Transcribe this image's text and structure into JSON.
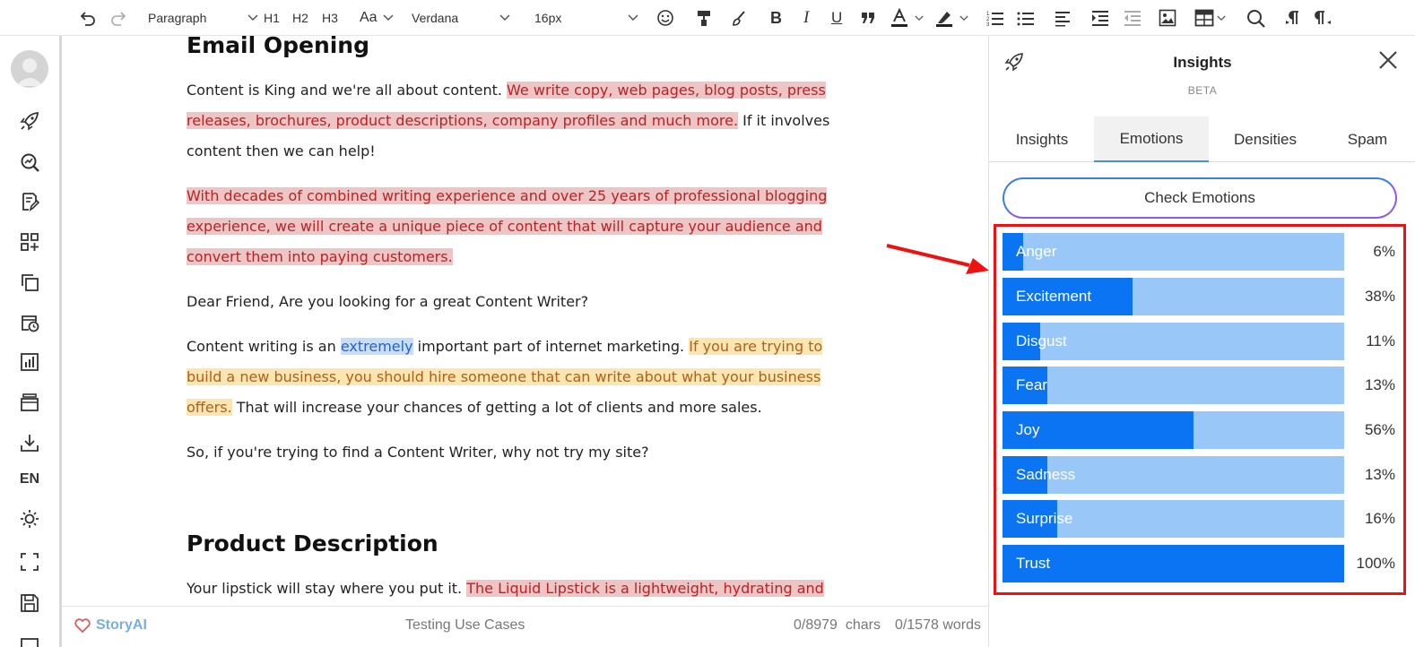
{
  "toolbar": {
    "block_format": "Paragraph",
    "h1": "H1",
    "h2": "H2",
    "h3": "H3",
    "text_case": "Aa",
    "font_family": "Verdana",
    "font_size": "16px"
  },
  "sidebar": {
    "language": "EN"
  },
  "document": {
    "heading1": "Email Opening",
    "p1": {
      "normal1": "Content is King and we're all about content. ",
      "hl1": "We write copy, web pages, blog posts, press releases, brochures, product descriptions, company profiles and much more.",
      "normal2": " If it involves content then we can help!"
    },
    "p2": {
      "hl1": "With decades of combined writing experience and over 25 years of professional blogging experience, we will create a unique piece of content that will capture your audience and convert them into paying customers."
    },
    "p3": {
      "normal1": "Dear Friend, Are you looking for a great Content Writer?"
    },
    "p4": {
      "normal1": "Content writing is an ",
      "hl_blue": "extremely",
      "normal2": " important part of internet marketing. ",
      "hl_yellow": "If you are trying to build a new business, you should hire someone that can write about what your business offers.",
      "normal3": " That will increase your chances of getting a lot of clients and more sales."
    },
    "p5": {
      "normal1": "So, if you're trying to find a Content Writer, why not try my site?"
    },
    "heading2": "Product Description",
    "p6": {
      "normal1": "Your lipstick will stay where you put it. ",
      "hl1": "The Liquid Lipstick is a lightweight, hydrating and"
    }
  },
  "statusbar": {
    "brand": "StoryAI",
    "doc_name": "Testing Use Cases",
    "chars": "0/8979  chars",
    "words": "0/1578 words"
  },
  "panel": {
    "title": "Insights",
    "subtitle": "BETA",
    "tabs": [
      "Insights",
      "Emotions",
      "Densities",
      "Spam"
    ],
    "active_tab": "Emotions",
    "check_button": "Check Emotions",
    "emotions": [
      {
        "name": "Anger",
        "percent": 6,
        "label": "6%"
      },
      {
        "name": "Excitement",
        "percent": 38,
        "label": "38%"
      },
      {
        "name": "Disgust",
        "percent": 11,
        "label": "11%"
      },
      {
        "name": "Fear",
        "percent": 13,
        "label": "13%"
      },
      {
        "name": "Joy",
        "percent": 56,
        "label": "56%"
      },
      {
        "name": "Sadness",
        "percent": 13,
        "label": "13%"
      },
      {
        "name": "Surprise",
        "percent": 16,
        "label": "16%"
      },
      {
        "name": "Trust",
        "percent": 100,
        "label": "100%"
      }
    ]
  },
  "colors": {
    "bar_fill": "#0a74f2",
    "bar_track": "#99c8f8",
    "highlight_box": "#ee1111",
    "highlight_red": "#efc4c4",
    "highlight_yellow": "#fbe5b0",
    "brand": "#7aaede"
  },
  "icons": {
    "toolbar": [
      "undo-icon",
      "redo-icon",
      "emoji-icon",
      "format-painter-icon",
      "clear-format-icon",
      "bold-icon",
      "italic-icon",
      "underline-icon",
      "quote-icon",
      "font-color-icon",
      "highlight-icon",
      "ordered-list-icon",
      "bullet-list-icon",
      "align-left-icon",
      "indent-icon",
      "outdent-icon",
      "image-icon",
      "table-icon",
      "search-icon",
      "ltr-icon",
      "rtl-icon"
    ],
    "sidebar": [
      "rocket-icon",
      "seo-search-icon",
      "edit-doc-icon",
      "apps-icon",
      "copy-icon",
      "schedule-icon",
      "chart-icon",
      "archive-icon",
      "download-icon",
      "brightness-icon",
      "fullscreen-icon",
      "save-icon"
    ]
  }
}
